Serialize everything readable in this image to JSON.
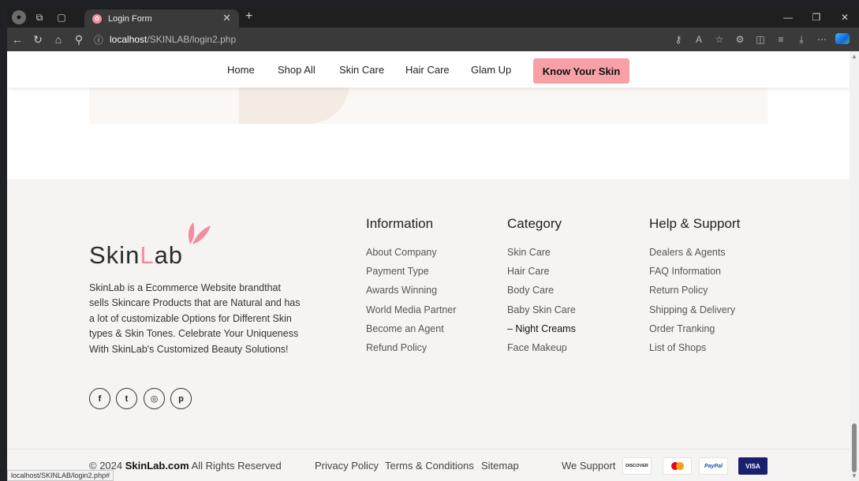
{
  "browser": {
    "tab_title": "Login Form",
    "url_host": "localhost",
    "url_path": "/SKINLAB/login2.php",
    "status_url": "localhost/SKINLAB/login2.php#"
  },
  "nav": {
    "links": [
      "Home",
      "Shop All",
      "Skin Care",
      "Hair Care",
      "Glam Up"
    ],
    "cta": "Know Your Skin"
  },
  "footer": {
    "logo_prefix": "Skin",
    "logo_L": "L",
    "logo_suffix": "ab",
    "description": "SkinLab is a Ecommerce Website brandthat sells Skincare Products that are Natural and has a lot of customizable Options for Different Skin types & Skin Tones. Celebrate Your Uniqueness With SkinLab's Customized Beauty Solutions!",
    "social_icons": [
      "facebook-icon",
      "twitter-icon",
      "instagram-icon",
      "pinterest-icon"
    ],
    "columns": [
      {
        "title": "Information",
        "items": [
          "About Company",
          "Payment Type",
          "Awards Winning",
          "World Media Partner",
          "Become an Agent",
          "Refund Policy"
        ]
      },
      {
        "title": "Category",
        "items": [
          "Skin Care",
          "Hair Care",
          "Body Care",
          "Baby Skin Care",
          "– Night Creams",
          "Face Makeup"
        ]
      },
      {
        "title": "Help & Support",
        "items": [
          "Dealers & Agents",
          "FAQ Information",
          "Return Policy",
          "Shipping & Delivery",
          "Order Tranking",
          "List of Shops"
        ]
      }
    ],
    "copyright_prefix": "© 2024",
    "copyright_brand": "SkinLab.com",
    "copyright_suffix": "All Rights Reserved",
    "bottom_links": [
      "Privacy Policy",
      "Terms & Conditions",
      "Sitemap"
    ],
    "we_support": "We Support",
    "cards": [
      "DISCOVER",
      "Mastercard",
      "PayPal",
      "VISA"
    ]
  },
  "colors": {
    "accent_pink": "#f7a1a6",
    "logo_pink": "#f48ca0",
    "footer_bg": "#f5f4f3"
  }
}
